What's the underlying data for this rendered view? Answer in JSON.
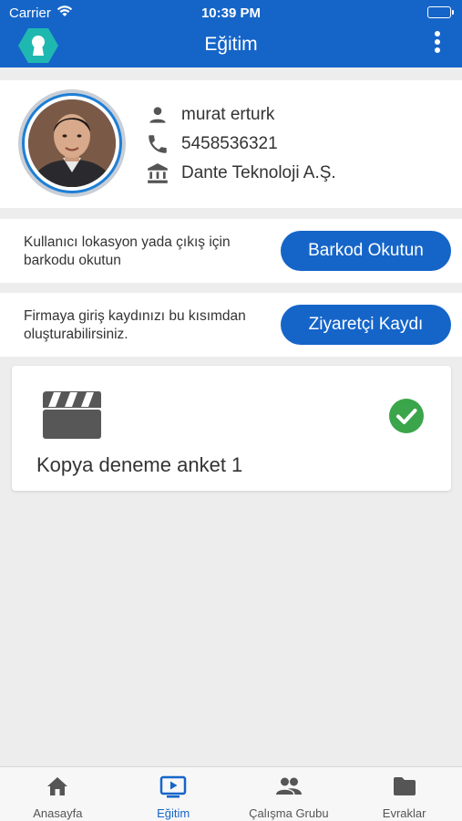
{
  "status_bar": {
    "carrier": "Carrier",
    "time": "10:39 PM"
  },
  "app_bar": {
    "title": "Eğitim"
  },
  "profile": {
    "name": "murat erturk",
    "phone": "5458536321",
    "company": "Dante Teknoloji A.Ş."
  },
  "barcode_section": {
    "description": "Kullanıcı lokasyon yada çıkış için barkodu okutun",
    "button_label": "Barkod Okutun"
  },
  "visitor_section": {
    "description": "Firmaya giriş kaydınızı bu kısımdan oluşturabilirsiniz.",
    "button_label": "Ziyaretçi Kaydı"
  },
  "training_card": {
    "title": "Kopya deneme anket 1",
    "icon": "video-clapperboard-icon",
    "status_icon": "check-circle-icon",
    "completed": true
  },
  "tabs": [
    {
      "label": "Anasayfa",
      "icon": "home-icon",
      "active": false
    },
    {
      "label": "Eğitim",
      "icon": "tv-play-icon",
      "active": true
    },
    {
      "label": "Çalışma Grubu",
      "icon": "group-icon",
      "active": false
    },
    {
      "label": "Evraklar",
      "icon": "folder-icon",
      "active": false
    }
  ],
  "colors": {
    "primary": "#1565c9",
    "success": "#3aa54a",
    "background": "#ededed",
    "tab_inactive": "#555555"
  }
}
